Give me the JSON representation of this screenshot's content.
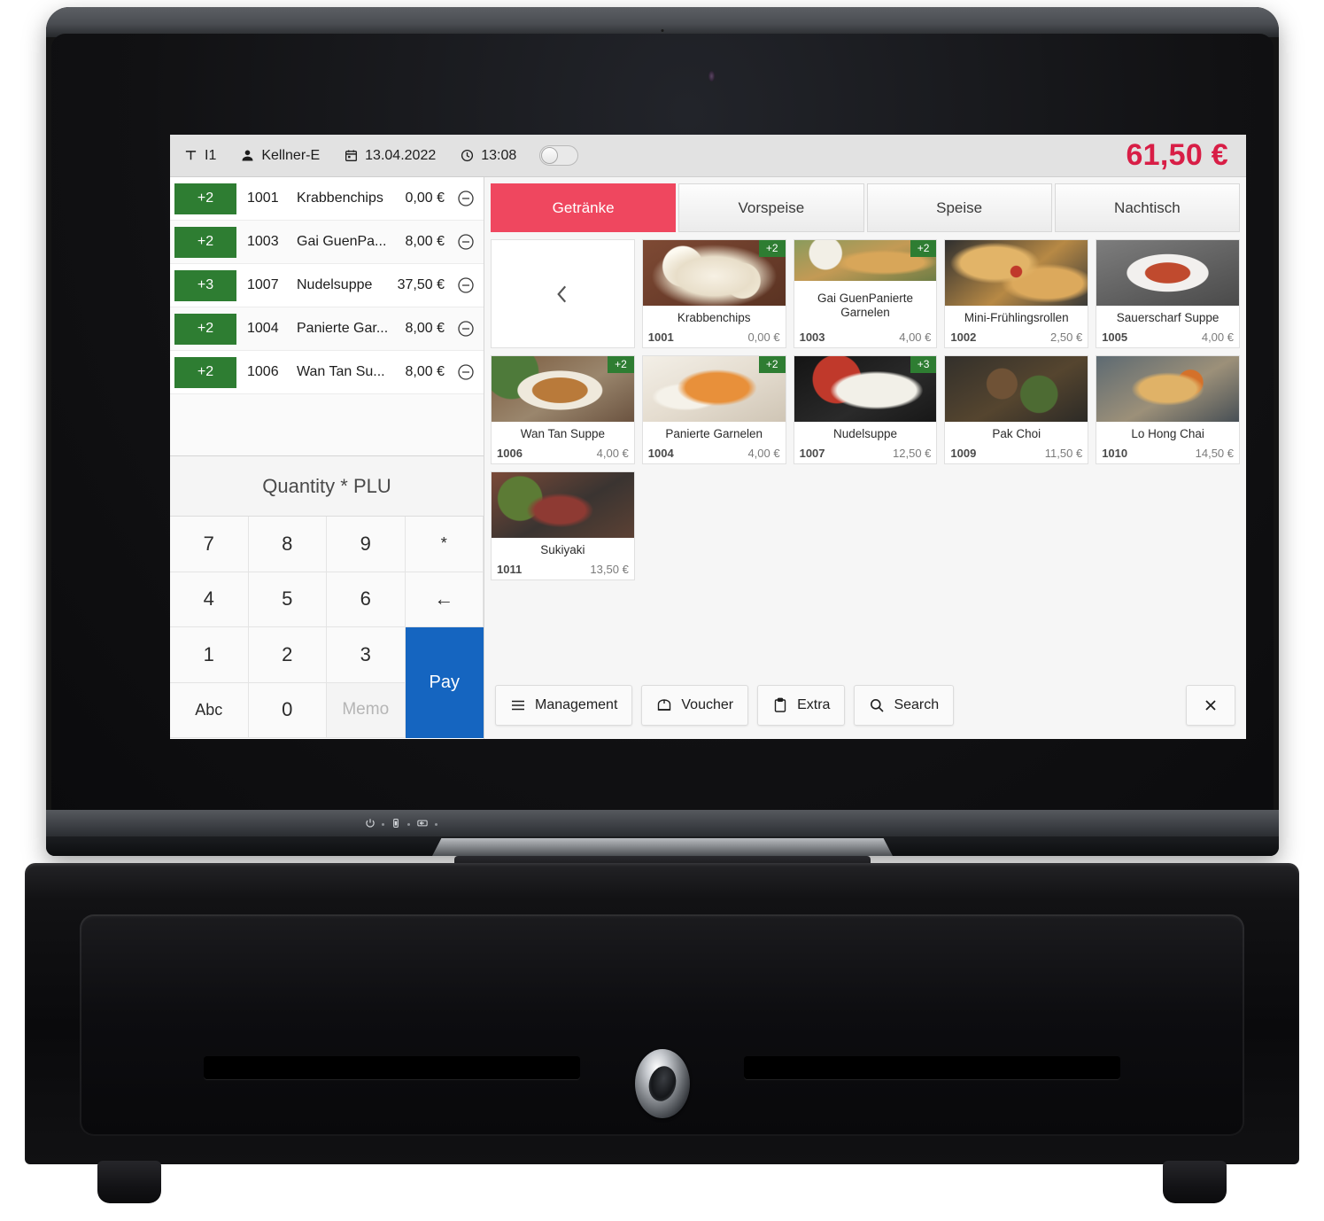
{
  "header": {
    "table_icon": "table-icon",
    "table_label": "I1",
    "user_icon": "user-icon",
    "user_label": "Kellner-E",
    "calendar_icon": "calendar-icon",
    "date": "13.04.2022",
    "clock_icon": "clock-icon",
    "time": "13:08",
    "toggle_state": "off",
    "total": "61,50 €",
    "total_color": "#d81e46"
  },
  "order": {
    "rows": [
      {
        "qty": "+2",
        "plu": "1001",
        "name": "Krabbenchips",
        "price": "0,00 €",
        "remove_icon": "minus-circle-icon"
      },
      {
        "qty": "+2",
        "plu": "1003",
        "name": "Gai GuenPa...",
        "price": "8,00 €",
        "remove_icon": "minus-circle-icon"
      },
      {
        "qty": "+3",
        "plu": "1007",
        "name": "Nudelsuppe",
        "price": "37,50 €",
        "remove_icon": "minus-circle-icon"
      },
      {
        "qty": "+2",
        "plu": "1004",
        "name": "Panierte Gar...",
        "price": "8,00 €",
        "remove_icon": "minus-circle-icon"
      },
      {
        "qty": "+2",
        "plu": "1006",
        "name": "Wan Tan Su...",
        "price": "8,00 €",
        "remove_icon": "minus-circle-icon"
      }
    ],
    "badge_color": "#2e7d32"
  },
  "keypad": {
    "title": "Quantity * PLU",
    "keys": [
      {
        "label": "7",
        "kind": "digit"
      },
      {
        "label": "8",
        "kind": "digit"
      },
      {
        "label": "9",
        "kind": "digit"
      },
      {
        "label": "*",
        "kind": "op"
      },
      {
        "label": "4",
        "kind": "digit"
      },
      {
        "label": "5",
        "kind": "digit"
      },
      {
        "label": "6",
        "kind": "digit"
      },
      {
        "label": "←",
        "kind": "backspace"
      },
      {
        "label": "1",
        "kind": "digit"
      },
      {
        "label": "2",
        "kind": "digit"
      },
      {
        "label": "3",
        "kind": "digit"
      },
      {
        "label": "Abc",
        "kind": "alpha"
      },
      {
        "label": "0",
        "kind": "digit"
      },
      {
        "label": "Memo",
        "kind": "memo"
      }
    ],
    "pay_label": "Pay",
    "pay_color": "#1565c0"
  },
  "tabs": [
    {
      "label": "Getränke",
      "active": true
    },
    {
      "label": "Vorspeise",
      "active": false
    },
    {
      "label": "Speise",
      "active": false
    },
    {
      "label": "Nachtisch",
      "active": false
    }
  ],
  "tabs_active_color": "#ef475f",
  "nav": {
    "prev_icon": "chevron-left-icon"
  },
  "products": [
    {
      "name": "Krabbenchips",
      "plu": "1001",
      "price": "0,00 €",
      "badge": "+2",
      "img": "ph-krabben"
    },
    {
      "name": "Gai GuenPanierte Garnelen",
      "plu": "1003",
      "price": "4,00 €",
      "badge": "+2",
      "img": "ph-gaiguen"
    },
    {
      "name": "Mini-Frühlingsrollen",
      "plu": "1002",
      "price": "2,50 €",
      "badge": "",
      "img": "ph-rollen"
    },
    {
      "name": "Sauerscharf Suppe",
      "plu": "1005",
      "price": "4,00 €",
      "badge": "",
      "img": "ph-sauer"
    },
    {
      "name": "Wan Tan Suppe",
      "plu": "1006",
      "price": "4,00 €",
      "badge": "+2",
      "img": "ph-wantan"
    },
    {
      "name": "Panierte Garnelen",
      "plu": "1004",
      "price": "4,00 €",
      "badge": "+2",
      "img": "ph-garnelen"
    },
    {
      "name": "Nudelsuppe",
      "plu": "1007",
      "price": "12,50 €",
      "badge": "+3",
      "img": "ph-nudel"
    },
    {
      "name": "Pak Choi",
      "plu": "1009",
      "price": "11,50 €",
      "badge": "",
      "img": "ph-pakchoi"
    },
    {
      "name": "Lo Hong Chai",
      "plu": "1010",
      "price": "14,50 €",
      "badge": "",
      "img": "ph-lohong"
    },
    {
      "name": "Sukiyaki",
      "plu": "1011",
      "price": "13,50 €",
      "badge": "",
      "img": "ph-sukiyaki"
    }
  ],
  "toolbar": {
    "management_label": "Management",
    "management_icon": "hamburger-icon",
    "voucher_label": "Voucher",
    "voucher_icon": "ticket-icon",
    "extra_label": "Extra",
    "extra_icon": "clipboard-icon",
    "search_label": "Search",
    "search_icon": "search-icon",
    "close_icon": "close-icon"
  },
  "hardware": {
    "power_icon": "power-icon",
    "battery_icon": "battery-icon",
    "display_icon": "display-icon",
    "drawer_lock_icon": "drawer-lock-icon"
  }
}
